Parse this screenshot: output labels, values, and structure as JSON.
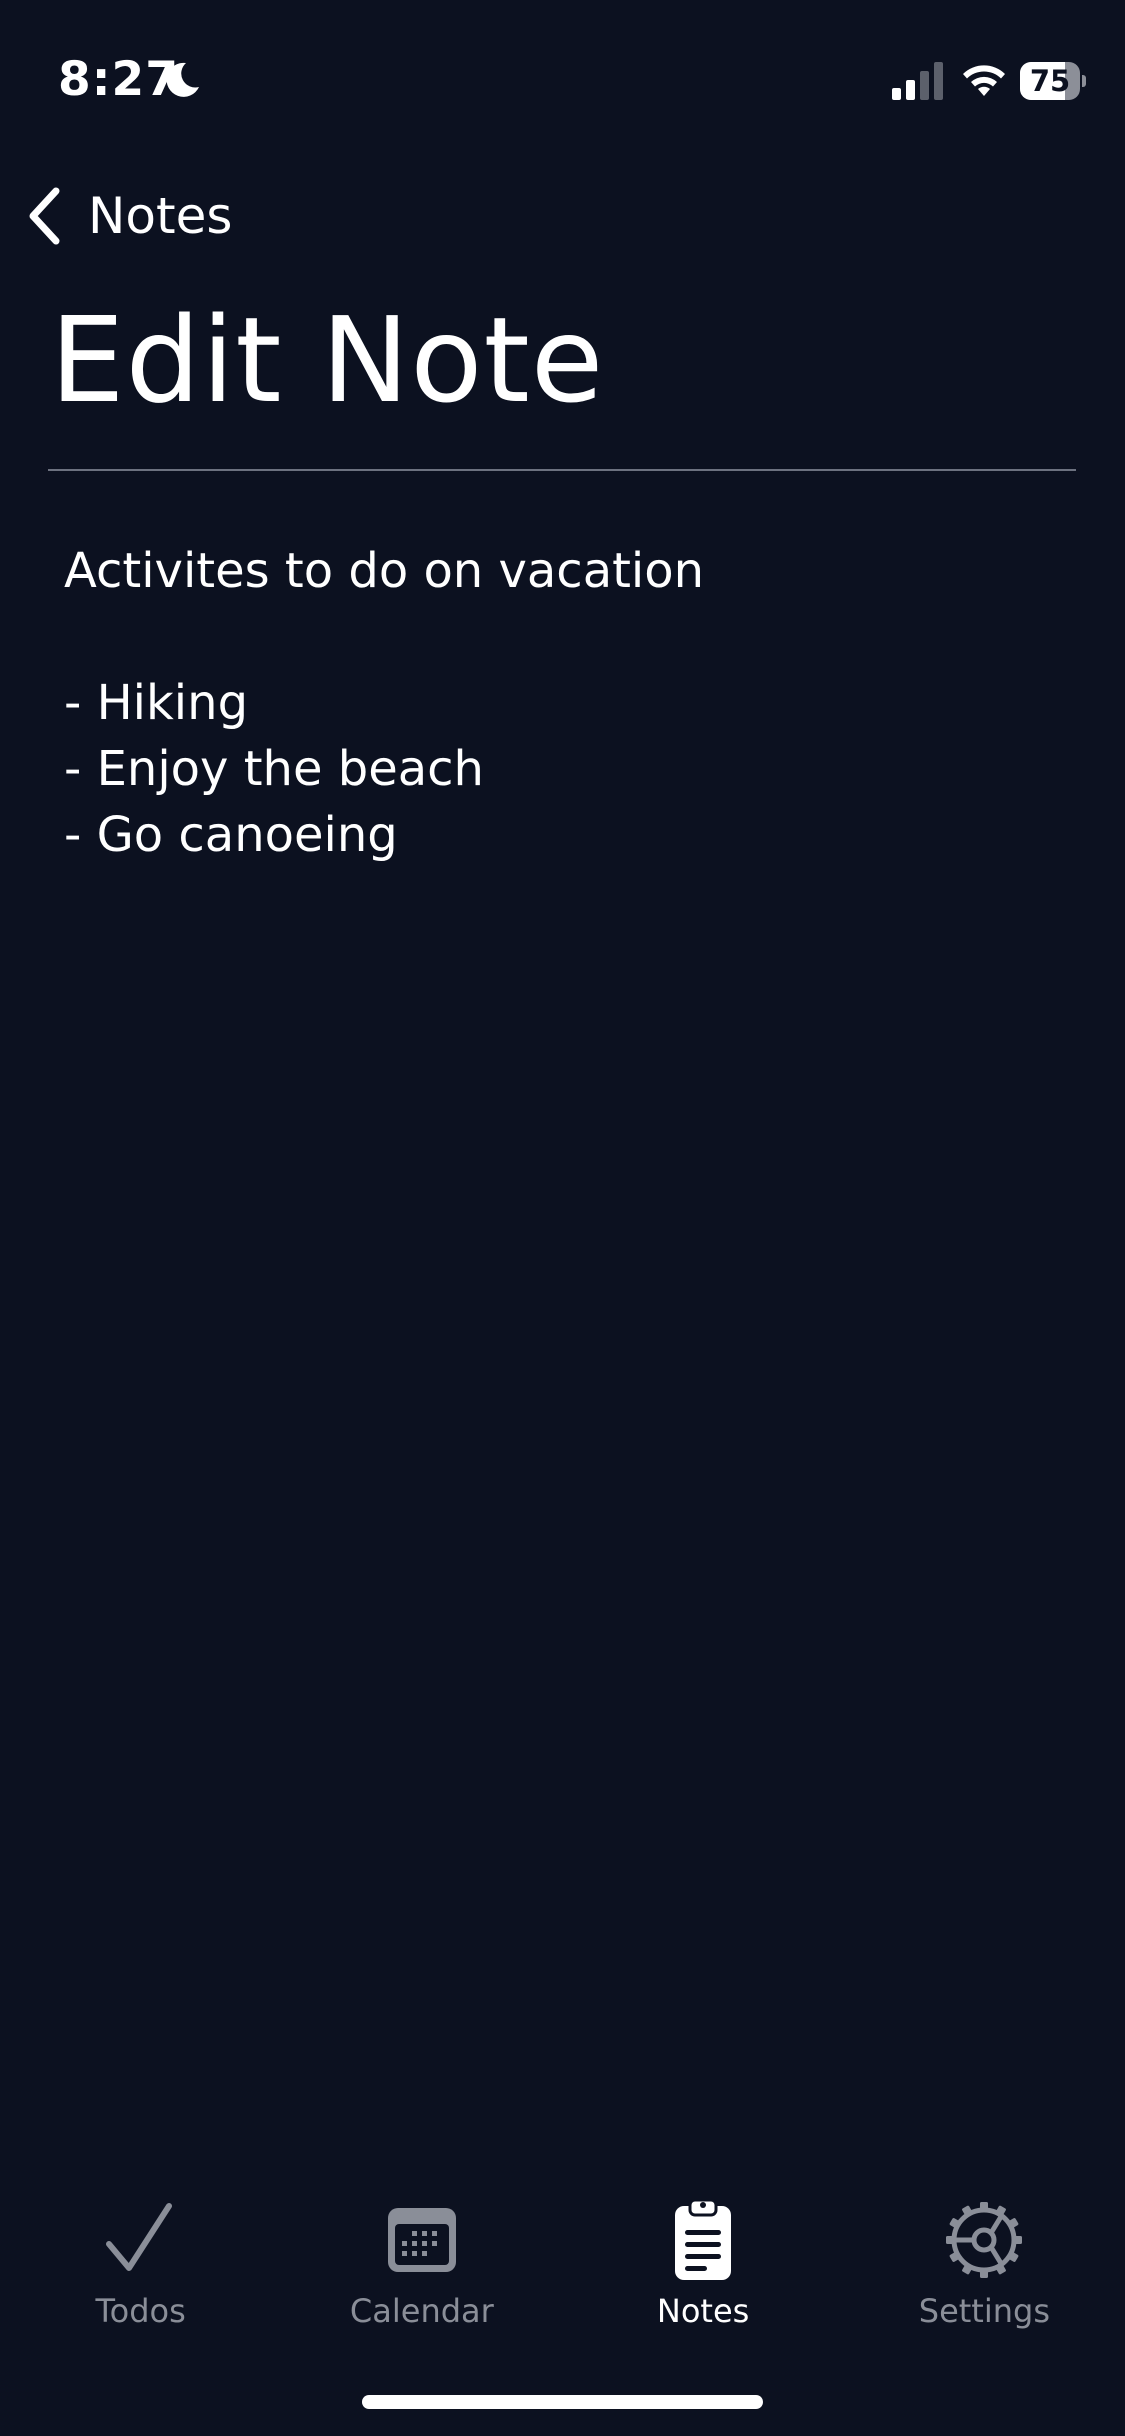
{
  "status_bar": {
    "time": "8:27",
    "battery_level": "75",
    "battery_fraction": 0.75,
    "icons": [
      "moon-icon",
      "cellular-signal-icon",
      "wifi-icon",
      "battery-icon"
    ]
  },
  "navigation": {
    "back_label": "Notes",
    "back_icon": "chevron-left-icon"
  },
  "page": {
    "title": "Edit Note"
  },
  "note": {
    "content": "Activites to do on vacation\n\n- Hiking\n- Enjoy the beach\n- Go canoeing"
  },
  "tab_bar": {
    "active_tab": "Notes",
    "tabs": [
      {
        "label": "Todos",
        "icon": "checkmark-icon"
      },
      {
        "label": "Calendar",
        "icon": "calendar-icon"
      },
      {
        "label": "Notes",
        "icon": "clipboard-icon"
      },
      {
        "label": "Settings",
        "icon": "gear-icon"
      }
    ]
  },
  "colors": {
    "background": "#0c1120",
    "text": "#ffffff",
    "inactive_tab": "#8a8e98",
    "divider": "#6d7280"
  }
}
